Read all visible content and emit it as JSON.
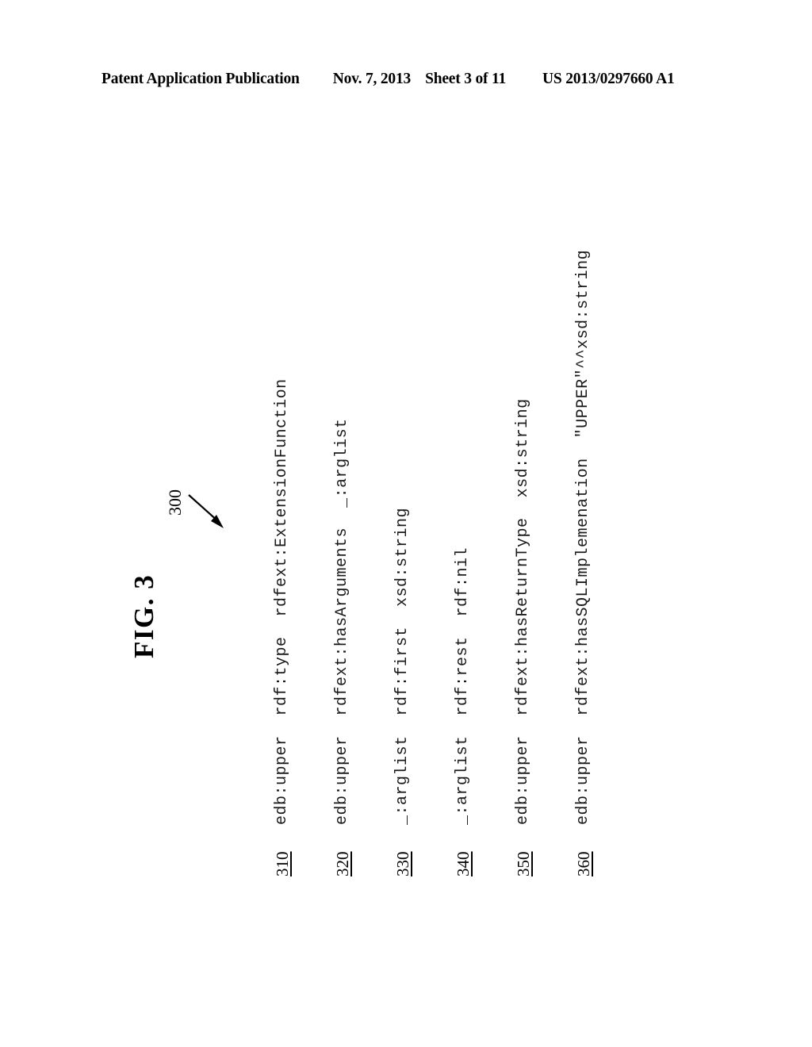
{
  "header": {
    "title": "Patent Application Publication",
    "date": "Nov. 7, 2013",
    "sheet": "Sheet 3 of 11",
    "publication_number": "US 2013/0297660 A1"
  },
  "figure": {
    "label": "FIG. 3",
    "callout": "300",
    "arrow_icon": "lead-line-arrow-icon"
  },
  "triples": [
    {
      "ref": "310",
      "subject": "edb:upper",
      "predicate": "rdf:type",
      "object": "rdfext:ExtensionFunction",
      "text": "edb:upper  rdf:type  rdfext:ExtensionFunction"
    },
    {
      "ref": "320",
      "subject": "edb:upper",
      "predicate": "rdfext:hasArguments",
      "object": "_:arglist",
      "text": "edb:upper  rdfext:hasArguments  _:arglist"
    },
    {
      "ref": "330",
      "subject": "_:arglist",
      "predicate": "rdf:first",
      "object": "xsd:string",
      "text": "_:arglist  rdf:first  xsd:string"
    },
    {
      "ref": "340",
      "subject": "_:arglist",
      "predicate": "rdf:rest",
      "object": "rdf:nil",
      "text": "_:arglist  rdf:rest  rdf:nil"
    },
    {
      "ref": "350",
      "subject": "edb:upper",
      "predicate": "rdfext:hasReturnType",
      "object": "xsd:string",
      "text": "edb:upper  rdfext:hasReturnType  xsd:string"
    },
    {
      "ref": "360",
      "subject": "edb:upper",
      "predicate": "rdfext:hasSQLImplemenation",
      "object": "\"UPPER\"^^xsd:string",
      "text": "edb:upper  rdfext:hasSQLImplemenation  \"UPPER\"^^xsd:string"
    }
  ]
}
